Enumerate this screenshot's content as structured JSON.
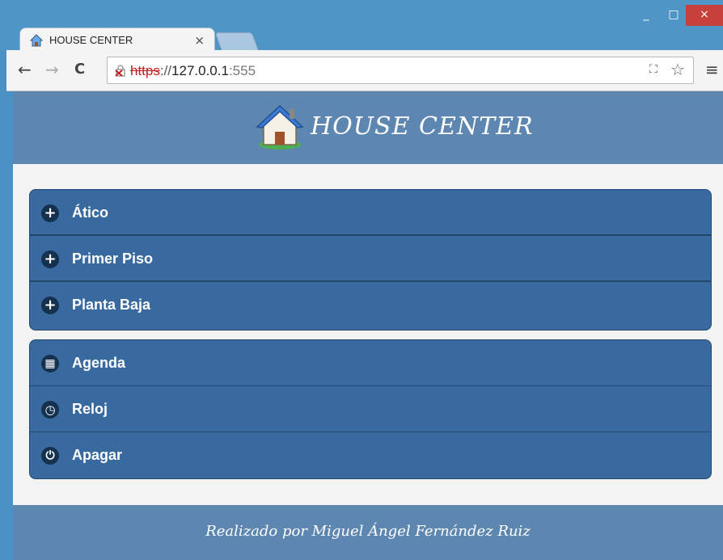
{
  "browser": {
    "tab_title": "HOUSE CENTER",
    "tab_close": "×",
    "window_minimize": "_",
    "window_maximize": "□",
    "window_close": "×",
    "nav_back": "←",
    "nav_forward": "→",
    "nav_reload": "C",
    "url_scheme": "https",
    "url_separator": "://",
    "url_host": "127.0.0.1",
    "url_port": ":555",
    "translate_icon": "⛶",
    "star_icon": "☆",
    "menu_icon": "≡"
  },
  "header": {
    "title": "HOUSE CENTER"
  },
  "menu_groups": [
    {
      "items": [
        {
          "label": "Ático",
          "icon": "plus-icon",
          "glyph": "+"
        },
        {
          "label": "Primer Piso",
          "icon": "plus-icon",
          "glyph": "+"
        },
        {
          "label": "Planta Baja",
          "icon": "plus-icon",
          "glyph": "+"
        }
      ]
    },
    {
      "items": [
        {
          "label": "Agenda",
          "icon": "calendar-icon",
          "glyph": "▦"
        },
        {
          "label": "Reloj",
          "icon": "clock-icon",
          "glyph": "◷"
        },
        {
          "label": "Apagar",
          "icon": "power-icon",
          "glyph": "⏻"
        }
      ]
    }
  ],
  "footer": {
    "credit": "Realizado por Miguel Ángel Fernández Ruiz"
  },
  "colors": {
    "window_frame": "#4f95c6",
    "header_bg": "#5d87b0",
    "menu_bg": "#386aa0",
    "page_bg": "#f3f3f3"
  }
}
